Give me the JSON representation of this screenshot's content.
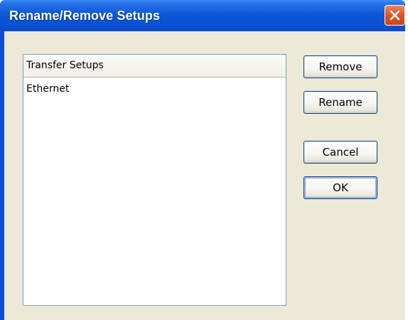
{
  "window": {
    "title": "Rename/Remove Setups",
    "close_icon": "close-icon"
  },
  "list": {
    "header": "Transfer Setups",
    "items": [
      "Ethernet"
    ]
  },
  "buttons": {
    "remove": "Remove",
    "rename": "Rename",
    "cancel": "Cancel",
    "ok": "OK"
  },
  "colors": {
    "titlebar": "#0a58d8",
    "client": "#ece9d8",
    "close_button": "#e2552b",
    "button_border": "#003c74"
  }
}
